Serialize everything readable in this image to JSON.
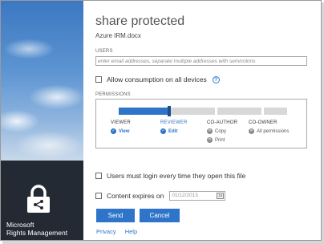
{
  "app": {
    "brand_line1": "Microsoft",
    "brand_line2": "Rights Management"
  },
  "dialog": {
    "title": "share protected",
    "filename": "Azure IRM.docx",
    "users_label": "USERS",
    "users_placeholder": "enter email addresses, separate multiple addresses with semicolons",
    "users_value": "",
    "allow_consumption_label": "Allow consumption on all devices",
    "allow_consumption_checked": false,
    "help_icon": "?",
    "permissions_label": "PERMISSIONS",
    "permission_levels": [
      {
        "name": "VIEWER",
        "active": false,
        "items": [
          {
            "label": "View",
            "granted": true
          }
        ]
      },
      {
        "name": "REVIEWER",
        "active": true,
        "items": [
          {
            "label": "Edit",
            "granted": true
          }
        ]
      },
      {
        "name": "CO-AUTHOR",
        "active": false,
        "items": [
          {
            "label": "Copy",
            "granted": false
          },
          {
            "label": "Print",
            "granted": false
          }
        ]
      },
      {
        "name": "CO-OWNER",
        "active": false,
        "items": [
          {
            "label": "All permissions",
            "granted": false
          }
        ]
      }
    ],
    "selected_level": "REVIEWER",
    "login_every_time_label": "Users must login every time they open this file",
    "login_every_time_checked": false,
    "content_expires_label": "Content expires on",
    "content_expires_checked": false,
    "expires_date_placeholder": "01/12/2013",
    "calendar_icon_text": "15",
    "send_label": "Send",
    "cancel_label": "Cancel",
    "privacy_label": "Privacy",
    "help_label": "Help"
  },
  "colors": {
    "accent": "#2e74c9",
    "brand_panel": "#242a33",
    "slider_inactive": "#d8d8d8"
  }
}
